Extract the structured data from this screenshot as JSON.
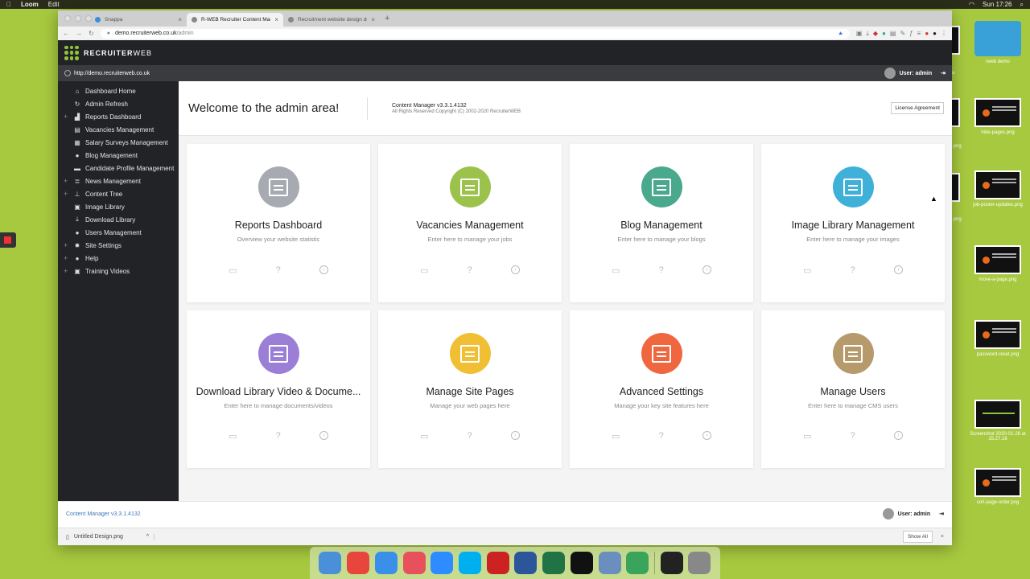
{
  "menubar": {
    "apple": "",
    "app": "Loom",
    "edit": "Edit",
    "clock": "Sun 17:26"
  },
  "desktop": {
    "folder": "rweb demo",
    "files": [
      "hide-pages.png",
      "job-poster-updates.png",
      "move-a-page.png",
      "password-reset.png",
      "Screenshot 2020-01-26 at 15.27.18",
      "sort-page-order.png"
    ],
    "partial_labels": [
      ".png",
      ".png"
    ],
    "folder_partial": "a"
  },
  "browser": {
    "tabs": [
      {
        "label": "Snappa",
        "active": false
      },
      {
        "label": "R-WEB Recruiter Content Man…",
        "active": true
      },
      {
        "label": "Recruitment website design de…",
        "active": false
      }
    ],
    "url_host": "demo.recruiterweb.co.uk",
    "url_path": "/admin"
  },
  "site": {
    "brand_bold": "RECRUITER",
    "brand_light": "WEB",
    "site_url": "http://demo.recruiterweb.co.uk",
    "user_label": "User: admin"
  },
  "sidebar": {
    "items": [
      {
        "label": "Dashboard Home",
        "icon": "home-icon",
        "glyph": "⌂",
        "plus": false
      },
      {
        "label": "Admin Refresh",
        "icon": "refresh-icon",
        "glyph": "↻",
        "plus": false
      },
      {
        "label": "Reports Dashboard",
        "icon": "chart-icon",
        "glyph": "▟",
        "plus": true
      },
      {
        "label": "Vacancies Management",
        "icon": "briefcase-icon",
        "glyph": "▤",
        "plus": false
      },
      {
        "label": "Salary Surveys Management",
        "icon": "survey-icon",
        "glyph": "▦",
        "plus": false
      },
      {
        "label": "Blog Management",
        "icon": "comment-icon",
        "glyph": "●",
        "plus": false
      },
      {
        "label": "Candidate Profile Management",
        "icon": "profile-icon",
        "glyph": "▬",
        "plus": false
      },
      {
        "label": "News Management",
        "icon": "news-icon",
        "glyph": "≣",
        "plus": true
      },
      {
        "label": "Content Tree",
        "icon": "tree-icon",
        "glyph": "⊥",
        "plus": true
      },
      {
        "label": "Image Library",
        "icon": "image-icon",
        "glyph": "▣",
        "plus": false
      },
      {
        "label": "Download Library",
        "icon": "download-icon",
        "glyph": "⤓",
        "plus": false
      },
      {
        "label": "Users Management",
        "icon": "users-icon",
        "glyph": "●",
        "plus": false
      },
      {
        "label": "Site Settings",
        "icon": "gear-icon",
        "glyph": "✹",
        "plus": true
      },
      {
        "label": "Help",
        "icon": "help-icon",
        "glyph": "",
        "plus": true
      },
      {
        "label": "Training Videos",
        "icon": "video-icon",
        "glyph": "▣",
        "plus": true
      }
    ]
  },
  "welcome": {
    "title": "Welcome to the admin area!",
    "version": "Content Manager v3.3.1.4132",
    "copyright": "All Rights Reserved Copyright (C) 2002-2020 RecruiterWEB",
    "license_button": "License Agreement"
  },
  "cards": [
    {
      "title": "Reports Dashboard",
      "subtitle": "Overview your website statistic",
      "color": "#a7abb1",
      "icon": "chart-icon"
    },
    {
      "title": "Vacancies Management",
      "subtitle": "Enter here to manage your jobs",
      "color": "#9bc24a",
      "icon": "document-edit-icon"
    },
    {
      "title": "Blog Management",
      "subtitle": "Enter here to manage your blogs",
      "color": "#4aa98c",
      "icon": "blog-icon"
    },
    {
      "title": "Image Library Management",
      "subtitle": "Enter here to manage your images",
      "color": "#3fb0d8",
      "icon": "image-gallery-icon"
    },
    {
      "title": "Download Library Video & Docume...",
      "subtitle": "Enter here to manage documents/videos",
      "color": "#9b7ed6",
      "icon": "media-icon"
    },
    {
      "title": "Manage Site Pages",
      "subtitle": "Manage your web pages here",
      "color": "#f0bf34",
      "icon": "pages-icon"
    },
    {
      "title": "Advanced Settings",
      "subtitle": "Manage your key site features here",
      "color": "#f0663f",
      "icon": "settings-icon"
    },
    {
      "title": "Manage Users",
      "subtitle": "Enter here to manage CMS users",
      "color": "#b69a6c",
      "icon": "users-icon"
    }
  ],
  "footer": {
    "version": "Content Manager v3.3.1.4132",
    "user_label": "User: admin"
  },
  "downloads": {
    "file": "Untitled Design.png",
    "show_all": "Show All"
  },
  "dock": [
    "finder",
    "chrome",
    "safari",
    "vectornator",
    "zoom",
    "skype",
    "vpn",
    "word",
    "excel",
    "infuse",
    "preview",
    "numbers",
    "screenshot",
    "trash"
  ]
}
